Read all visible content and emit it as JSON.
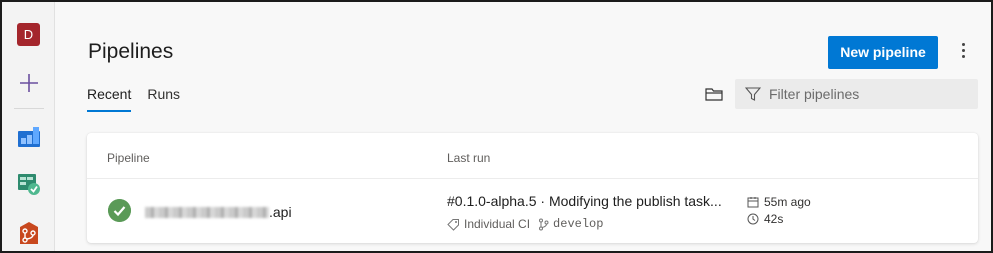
{
  "sidebar": {
    "avatar_initial": "D",
    "avatar_color": "#a4262c"
  },
  "header": {
    "title": "Pipelines",
    "new_button": "New pipeline"
  },
  "tabs": [
    {
      "label": "Recent",
      "active": true
    },
    {
      "label": "Runs",
      "active": false
    }
  ],
  "filter": {
    "placeholder": "Filter pipelines"
  },
  "table": {
    "columns": [
      "Pipeline",
      "Last run"
    ],
    "rows": [
      {
        "status": "succeeded",
        "pipeline_suffix": ".api",
        "run_title": "#0.1.0-alpha.5 · Modifying the publish task...",
        "trigger": "Individual CI",
        "branch": "develop",
        "ago": "55m ago",
        "duration": "42s"
      }
    ]
  },
  "colors": {
    "accent": "#0078d4",
    "success": "#5a9a57"
  }
}
